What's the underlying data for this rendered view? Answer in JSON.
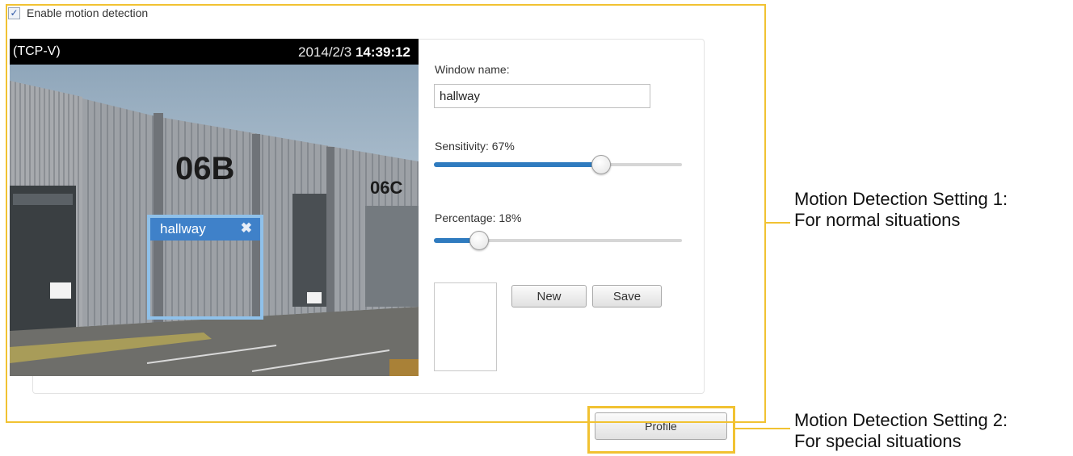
{
  "enable_motion": {
    "label": "Enable motion detection",
    "checked": true
  },
  "video": {
    "stream_label": "(TCP-V)",
    "date": "2014/2/3",
    "time": "14:39:12",
    "scene_text": {
      "unit_a": "06B",
      "unit_b": "06C"
    },
    "motion_window": {
      "name": "hallway",
      "close_icon": "close-icon"
    }
  },
  "controls": {
    "window_name_label": "Window name:",
    "window_name_value": "hallway",
    "sensitivity_label": "Sensitivity: 67%",
    "sensitivity_value": 67,
    "percentage_label": "Percentage: 18%",
    "percentage_value": 18,
    "new_label": "New",
    "save_label": "Save",
    "profile_label": "Profile"
  },
  "annotations": {
    "setting1_line1": "Motion Detection Setting 1:",
    "setting1_line2": "For normal situations",
    "setting2_line1": "Motion Detection Setting 2:",
    "setting2_line2": "For special situations"
  },
  "colors": {
    "frame": "#f1c232",
    "accent": "#2f7bbf",
    "motion_header": "#3f81c9"
  }
}
